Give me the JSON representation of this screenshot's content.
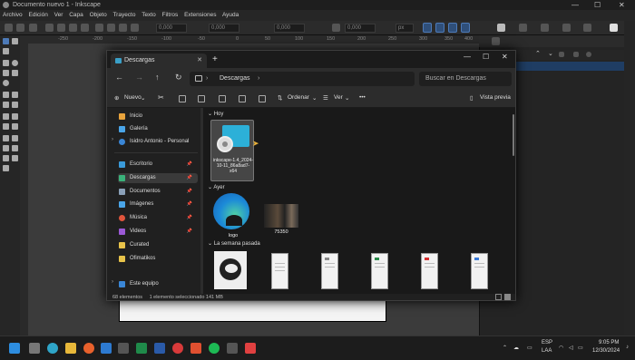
{
  "inkscape": {
    "window_title": "Documento nuevo 1 - Inkscape",
    "menu": [
      "Archivo",
      "Edición",
      "Ver",
      "Capa",
      "Objeto",
      "Trayecto",
      "Texto",
      "Filtros",
      "Extensiones",
      "Ayuda"
    ],
    "fields": {
      "x": "0,000",
      "y": "0,000",
      "w": "0,000",
      "h": "0,000",
      "unit": "px"
    },
    "ruler_ticks": [
      "-250",
      "-200",
      "-150",
      "-100",
      "-50",
      "0",
      "50",
      "100",
      "150",
      "200",
      "250",
      "300",
      "350",
      "400"
    ]
  },
  "explorer": {
    "tab_title": "Descargas",
    "address": "Descargas",
    "search_placeholder": "Buscar en Descargas",
    "toolbar": {
      "new": "Nuevo",
      "sort": "Ordenar",
      "view": "Ver",
      "more": "•••",
      "preview": "Vista previa"
    },
    "sidebar": [
      {
        "label": "Inicio",
        "pinned": false,
        "color": "#e8a33c"
      },
      {
        "label": "Galería",
        "pinned": false,
        "color": "#4aa5e8"
      },
      {
        "label": "Isidro Antonio - Personal",
        "pinned": false,
        "color": "#3a86d6"
      },
      {
        "label": "Escritorio",
        "pinned": true,
        "color": "#3a9ad9"
      },
      {
        "label": "Descargas",
        "pinned": true,
        "color": "#3ab27a"
      },
      {
        "label": "Documentos",
        "pinned": true,
        "color": "#8aa0b8"
      },
      {
        "label": "Imágenes",
        "pinned": true,
        "color": "#4aa5e8"
      },
      {
        "label": "Música",
        "pinned": true,
        "color": "#e0553c"
      },
      {
        "label": "Videos",
        "pinned": true,
        "color": "#9b59d6"
      },
      {
        "label": "Curated",
        "pinned": false,
        "color": "#e8c34a"
      },
      {
        "label": "Ofimatikos",
        "pinned": false,
        "color": "#e8c34a"
      },
      {
        "label": "Este equipo",
        "pinned": false,
        "color": "#3a86d6"
      }
    ],
    "groups": {
      "today": "Hoy",
      "yesterday": "Ayer",
      "last_week": "La semana pasada"
    },
    "files": {
      "inkscape": "inkscape-1.4_2024-10-11_86a8ad7-x64",
      "logo": "logo",
      "photo": "75350"
    },
    "status": {
      "count": "68 elementos",
      "selected": "1 elemento seleccionado  141 MB"
    }
  },
  "taskbar": {
    "lang_top": "ESP",
    "lang_bottom": "LAA",
    "time": "9:05 PM",
    "date": "12/30/2024"
  }
}
